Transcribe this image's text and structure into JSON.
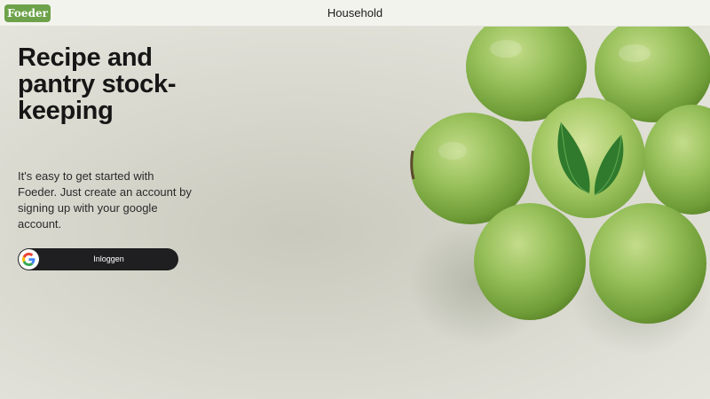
{
  "header": {
    "logo_text": "Foeder",
    "title": "Household"
  },
  "hero": {
    "headline": "Recipe and pantry stock-keeping",
    "description": "It's easy to get started with Foeder. Just create an account by signing up with your google account.",
    "login_button_label": "Inloggen",
    "login_icon": "google-icon",
    "image_subject": "green-apples-image"
  },
  "colors": {
    "brand": "#6da24a",
    "button_bg": "#1f1f21",
    "background": "#dcdcd3"
  }
}
